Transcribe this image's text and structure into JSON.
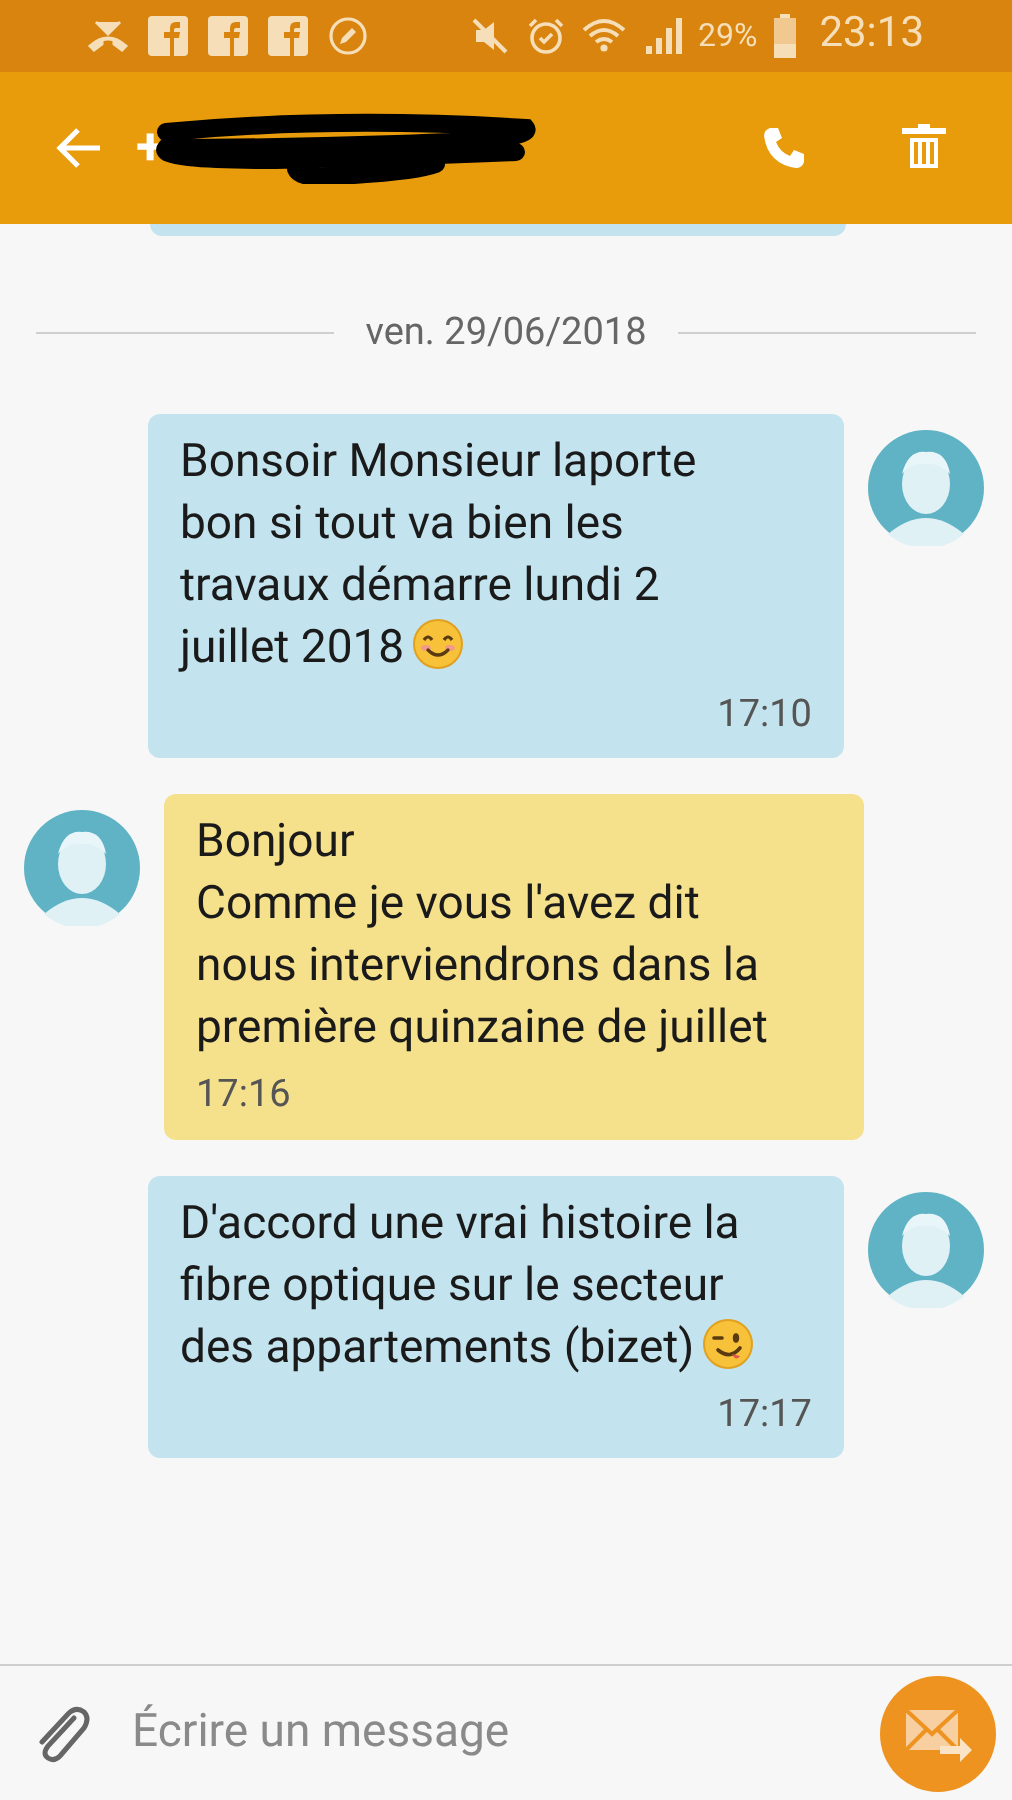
{
  "status_bar": {
    "battery": "29%",
    "time": "23:13"
  },
  "header": {
    "title": "+"
  },
  "date_separator": "ven. 29/06/2018",
  "messages": [
    {
      "kind": "outgoing",
      "text": "Bonsoir Monsieur laporte bon si tout va bien les travaux démarre lundi 2 juillet 2018",
      "emoji": {
        "kind": "smiling"
      },
      "time": "17:10"
    },
    {
      "kind": "incoming",
      "text": "Bonjour\nComme je vous l'avez dit nous interviendrons dans la première quinzaine de juillet",
      "time": "17:16"
    },
    {
      "kind": "outgoing",
      "text": "D'accord une vrai histoire la fibre optique sur le secteur des appartements (bizet)",
      "emoji": {
        "kind": "winking"
      },
      "time": "17:17"
    }
  ],
  "composer": {
    "placeholder": "Écrire un message"
  }
}
